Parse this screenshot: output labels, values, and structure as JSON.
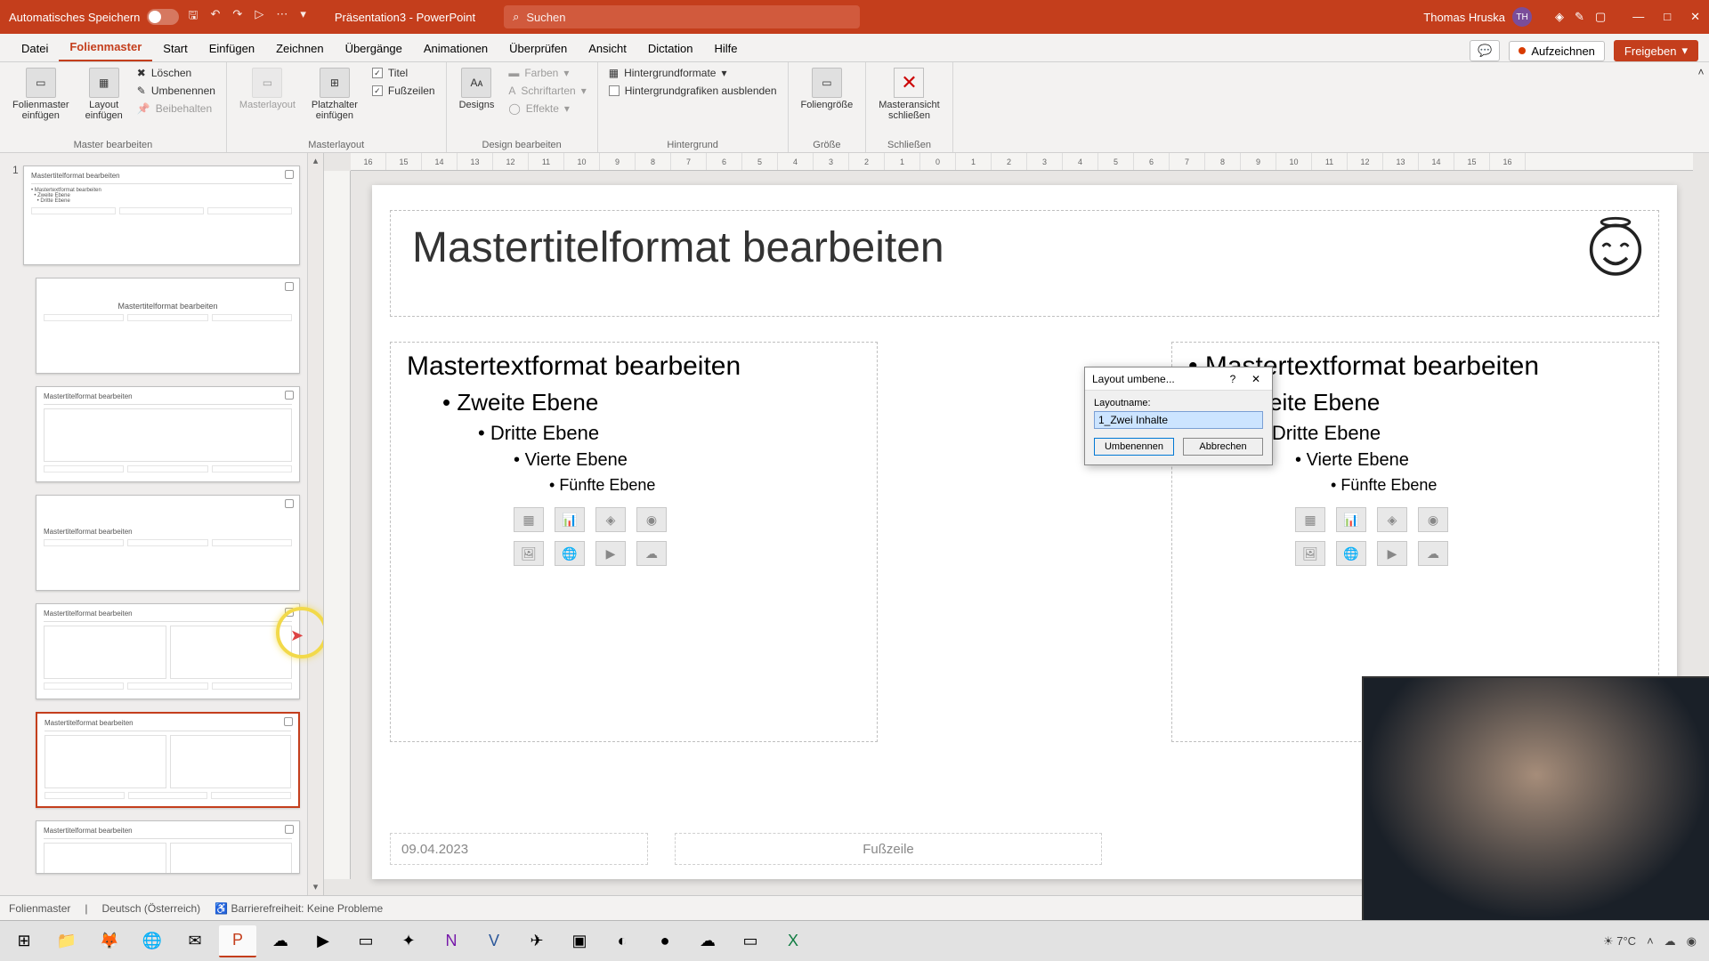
{
  "titlebar": {
    "autosave_label": "Automatisches Speichern",
    "doc_title": "Präsentation3 - PowerPoint",
    "search_placeholder": "Suchen",
    "user_name": "Thomas Hruska",
    "user_initials": "TH"
  },
  "tabs": {
    "datei": "Datei",
    "folienmaster": "Folienmaster",
    "start": "Start",
    "einfuegen": "Einfügen",
    "zeichnen": "Zeichnen",
    "uebergaenge": "Übergänge",
    "animationen": "Animationen",
    "ueberpruefen": "Überprüfen",
    "ansicht": "Ansicht",
    "dictation": "Dictation",
    "hilfe": "Hilfe",
    "aufzeichnen": "Aufzeichnen",
    "freigeben": "Freigeben"
  },
  "ribbon": {
    "folienmaster_einfuegen": "Folienmaster\neinfügen",
    "layout_einfuegen": "Layout\neinfügen",
    "loeschen": "Löschen",
    "umbenennen": "Umbenennen",
    "beibehalten": "Beibehalten",
    "master_bearbeiten": "Master bearbeiten",
    "masterlayout": "Masterlayout",
    "platzhalter_einfuegen": "Platzhalter\neinfügen",
    "titel": "Titel",
    "fusszeilen": "Fußzeilen",
    "masterlayout_group": "Masterlayout",
    "designs": "Designs",
    "farben": "Farben",
    "schriftarten": "Schriftarten",
    "effekte": "Effekte",
    "design_bearbeiten": "Design bearbeiten",
    "hintergrundformate": "Hintergrundformate",
    "hintergrundgrafiken": "Hintergrundgrafiken ausblenden",
    "hintergrund": "Hintergrund",
    "foliengroesse": "Foliengröße",
    "groesse": "Größe",
    "masteransicht_schliessen": "Masteransicht\nschließen",
    "schliessen": "Schließen"
  },
  "slide": {
    "title": "Mastertitelformat bearbeiten",
    "lvl1": "Mastertextformat bearbeiten",
    "lvl2": "Zweite Ebene",
    "lvl3": "Dritte Ebene",
    "lvl4": "Vierte Ebene",
    "lvl5": "Fünfte Ebene",
    "date": "09.04.2023",
    "footer": "Fußzeile"
  },
  "dialog": {
    "title": "Layout umbene...",
    "label": "Layoutname:",
    "value": "1_Zwei Inhalte",
    "ok": "Umbenennen",
    "cancel": "Abbrechen"
  },
  "status": {
    "mode": "Folienmaster",
    "lang": "Deutsch (Österreich)",
    "accessibility": "Barrierefreiheit: Keine Probleme"
  },
  "ruler": [
    "16",
    "15",
    "14",
    "13",
    "12",
    "11",
    "10",
    "9",
    "8",
    "7",
    "6",
    "5",
    "4",
    "3",
    "2",
    "1",
    "0",
    "1",
    "2",
    "3",
    "4",
    "5",
    "6",
    "7",
    "8",
    "9",
    "10",
    "11",
    "12",
    "13",
    "14",
    "15",
    "16"
  ],
  "thumbs": {
    "master_num": "1",
    "t1": "Mastertitelformat bearbeiten",
    "t2": "Mastertitelformat bearbeiten",
    "t3": "Mastertitelformat bearbeiten",
    "t4": "Mastertitelformat bearbeiten",
    "t5": "Mastertitelformat bearbeiten",
    "t6": "Mastertitelformat bearbeiten",
    "t7": "Mastertitelformat bearbeiten"
  },
  "taskbar": {
    "temp": "7°C"
  }
}
